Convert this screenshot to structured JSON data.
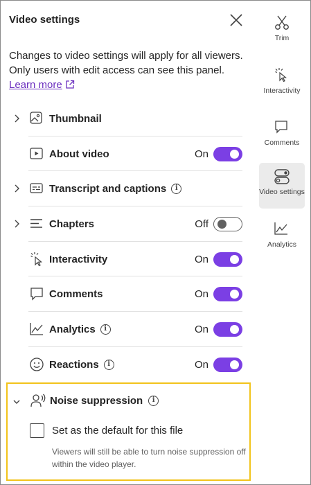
{
  "panel": {
    "title": "Video settings",
    "description": "Changes to video settings will apply for all viewers. Only users with edit access can see this panel.",
    "learn_more": "Learn more"
  },
  "settings": [
    {
      "label": "Thumbnail",
      "icon": "image-icon",
      "expandable": true,
      "info": false,
      "state": "",
      "toggle": null
    },
    {
      "label": "About video",
      "icon": "play-box-icon",
      "expandable": false,
      "info": false,
      "state": "On",
      "toggle": true
    },
    {
      "label": "Transcript and captions",
      "icon": "captions-icon",
      "expandable": true,
      "info": true,
      "state": "",
      "toggle": null
    },
    {
      "label": "Chapters",
      "icon": "chapters-icon",
      "expandable": true,
      "info": false,
      "state": "Off",
      "toggle": false
    },
    {
      "label": "Interactivity",
      "icon": "interactivity-cursor-icon",
      "expandable": false,
      "info": false,
      "state": "On",
      "toggle": true
    },
    {
      "label": "Comments",
      "icon": "comment-icon",
      "expandable": false,
      "info": false,
      "state": "On",
      "toggle": true
    },
    {
      "label": "Analytics",
      "icon": "analytics-chart-icon",
      "expandable": false,
      "info": true,
      "state": "On",
      "toggle": true
    },
    {
      "label": "Reactions",
      "icon": "smiley-icon",
      "expandable": false,
      "info": true,
      "state": "On",
      "toggle": true
    }
  ],
  "noise": {
    "label": "Noise suppression",
    "checkbox_label": "Set as the default for this file",
    "checked": false,
    "note": "Viewers will still be able to turn noise suppression off within the video player."
  },
  "rail": [
    {
      "label": "Trim",
      "icon": "scissors-icon",
      "active": false
    },
    {
      "label": "Interactivity",
      "icon": "interactivity-cursor-icon",
      "active": false
    },
    {
      "label": "Comments",
      "icon": "comment-icon",
      "active": false
    },
    {
      "label": "Video settings",
      "icon": "toggles-icon",
      "active": true
    },
    {
      "label": "Analytics",
      "icon": "analytics-chart-icon",
      "active": false
    }
  ],
  "colors": {
    "accent": "#7b3fe4",
    "link": "#6b2fbf",
    "highlight_border": "#f2c31a"
  }
}
